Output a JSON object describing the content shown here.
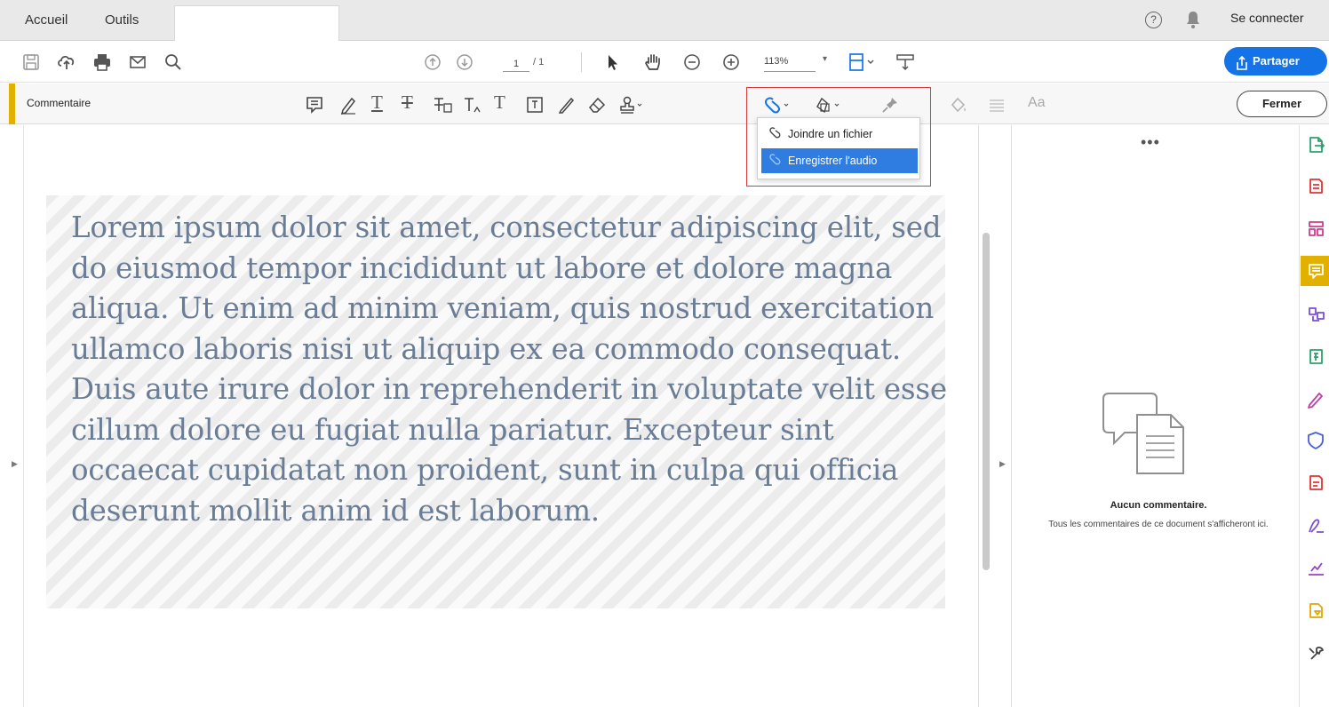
{
  "tabs": {
    "home": "Accueil",
    "tools": "Outils"
  },
  "header": {
    "help_glyph": "?",
    "signin": "Se connecter"
  },
  "toolbar": {
    "page_current": "1",
    "page_total": "/ 1",
    "zoom": "113%",
    "zoom_arrow": "▾",
    "share_label": "Partager"
  },
  "comment_toolbar": {
    "title": "Commentaire",
    "text_glyph": "T",
    "font_label": "Aa",
    "close_label": "Fermer"
  },
  "attach_menu": {
    "items": [
      {
        "label": "Joindre un fichier",
        "selected": false
      },
      {
        "label": "Enregistrer l'audio",
        "selected": true
      }
    ]
  },
  "document": {
    "text": "Lorem ipsum dolor sit amet, consectetur adipiscing elit, sed do eiusmod tempor incididunt ut labore et dolore magna aliqua. Ut enim ad minim veniam, quis nostrud exercitation ullamco laboris nisi ut aliquip ex ea commodo consequat. Duis aute irure dolor in reprehenderit in voluptate velit esse cillum dolore eu fugiat nulla pariatur. Excepteur sint occaecat cupidatat non proident, sunt in culpa qui officia deserunt mollit anim id est laborum."
  },
  "comments_pane": {
    "more": "•••",
    "empty_title": "Aucun commentaire.",
    "empty_desc": "Tous les commentaires de ce document s'afficheront ici."
  },
  "rail": {
    "items": [
      {
        "icon": "export-pdf-icon",
        "color": "#2aa36b"
      },
      {
        "icon": "create-pdf-icon",
        "color": "#e03434"
      },
      {
        "icon": "organize-pages-icon",
        "color": "#d13b8e"
      },
      {
        "icon": "comment-icon",
        "color": "#ffffff",
        "active": true
      },
      {
        "icon": "combine-files-icon",
        "color": "#7b4fd4"
      },
      {
        "icon": "edit-pdf-icon",
        "color": "#2aa36b"
      },
      {
        "icon": "fill-sign-icon",
        "color": "#c03ea8"
      },
      {
        "icon": "protect-icon",
        "color": "#4a5fd6"
      },
      {
        "icon": "export-pdf-red-icon",
        "color": "#e03434"
      },
      {
        "icon": "send-for-signature-icon",
        "color": "#7b4fd4"
      },
      {
        "icon": "measure-icon",
        "color": "#9c3fd0"
      },
      {
        "icon": "send-track-icon",
        "color": "#e0a800"
      },
      {
        "icon": "more-tools-icon",
        "color": "#444444"
      }
    ]
  }
}
